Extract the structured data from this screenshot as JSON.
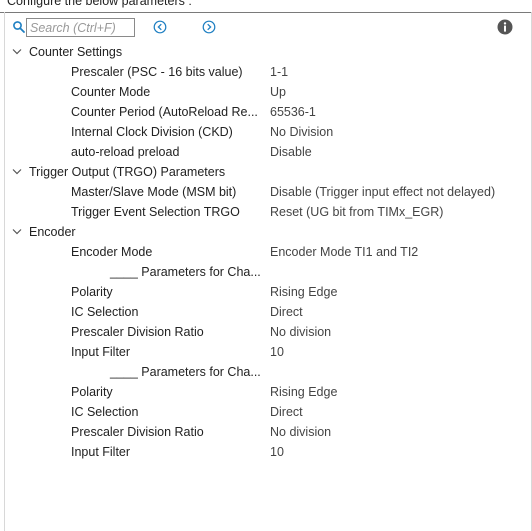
{
  "header": {
    "title": "Configure the below parameters :"
  },
  "search": {
    "placeholder": "Search (Ctrl+F)",
    "value": ""
  },
  "icons": {
    "search": "search-icon",
    "prev": "circle-arrow-left-icon",
    "next": "circle-arrow-right-icon",
    "info": "info-icon",
    "expand": "chevron-down-icon"
  },
  "colors": {
    "accent": "#1e7fc2",
    "info": "#555555"
  },
  "groups": [
    {
      "label": "Counter Settings",
      "params": [
        {
          "label": "Prescaler (PSC - 16 bits value)",
          "value": "1-1"
        },
        {
          "label": "Counter Mode",
          "value": "Up"
        },
        {
          "label": "Counter Period (AutoReload Re...",
          "value": "65536-1"
        },
        {
          "label": "Internal Clock Division (CKD)",
          "value": "No Division"
        },
        {
          "label": "auto-reload preload",
          "value": "Disable"
        }
      ]
    },
    {
      "label": "Trigger Output (TRGO) Parameters",
      "params": [
        {
          "label": "Master/Slave Mode (MSM bit)",
          "value": "Disable (Trigger input effect not delayed)"
        },
        {
          "label": "Trigger Event Selection TRGO",
          "value": "Reset (UG bit from TIMx_EGR)"
        }
      ]
    },
    {
      "label": "Encoder",
      "params": [
        {
          "label": "Encoder Mode",
          "value": "Encoder Mode TI1 and TI2"
        },
        {
          "sub": "____ Parameters for Cha..."
        },
        {
          "label": "Polarity",
          "value": "Rising Edge"
        },
        {
          "label": "IC Selection",
          "value": "Direct"
        },
        {
          "label": "Prescaler Division Ratio",
          "value": "No division"
        },
        {
          "label": "Input Filter",
          "value": "10"
        },
        {
          "sub": "____ Parameters for Cha..."
        },
        {
          "label": "Polarity",
          "value": "Rising Edge"
        },
        {
          "label": "IC Selection",
          "value": "Direct"
        },
        {
          "label": "Prescaler Division Ratio",
          "value": "No division"
        },
        {
          "label": "Input Filter",
          "value": "10"
        }
      ]
    }
  ]
}
